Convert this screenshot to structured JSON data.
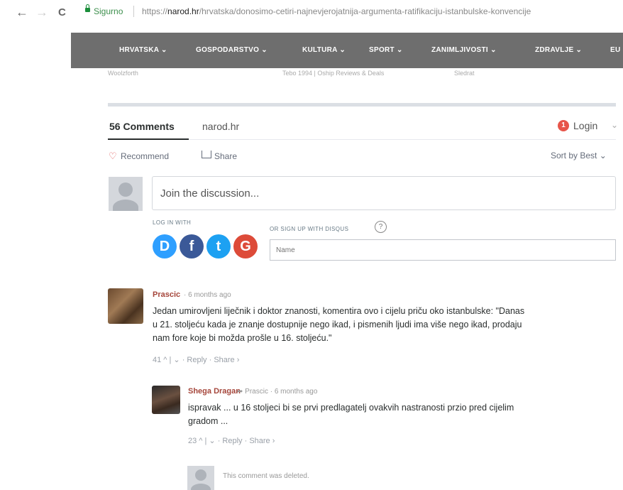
{
  "browser": {
    "back": "←",
    "forward": "→",
    "reload": "C",
    "secure_label": "Sigurno",
    "url_scheme": "https://",
    "url_domain": "narod.hr",
    "url_path": "/hrvatska/donosimo-cetiri-najnevjerojatnija-argumenta-ratifikaciju-istanbulske-konvencije"
  },
  "site_menu": [
    {
      "label": "HRVATSKA ⌄"
    },
    {
      "label": "GOSPODARSTVO ⌄"
    },
    {
      "label": "KULTURA ⌄"
    },
    {
      "label": "SPORT ⌄"
    },
    {
      "label": "ZANIMLJIVOSTI ⌄"
    },
    {
      "label": "ZDRAVLJE ⌄"
    },
    {
      "label": "EU"
    }
  ],
  "blurred_row": [
    "Woolzforth",
    "Tebo 1994 | Oship Reviews & Deals",
    "Sledrat"
  ],
  "disqus": {
    "comment_count": "56 Comments",
    "forum": "narod.hr",
    "login_badge": "1",
    "login": "Login",
    "login_caret": "⌄",
    "recommend": "Recommend",
    "share": "Share",
    "sort": "Sort by Best ⌄",
    "join_placeholder": "Join the discussion...",
    "log_in_with": "LOG IN WITH",
    "sign_up": "OR SIGN UP WITH DISQUS",
    "qmark": "?",
    "name_placeholder": "Name",
    "social": [
      {
        "letter": "D",
        "color": "#2e9fff"
      },
      {
        "letter": "f",
        "color": "#3b5998"
      },
      {
        "letter": "t",
        "color": "#1da1f2"
      },
      {
        "letter": "G",
        "color": "#dd4b39"
      }
    ]
  },
  "comments": [
    {
      "author": "Prascic",
      "meta": "· 6 months ago",
      "lines": [
        "Jedan umirovljeni liječnik i doktor znanosti, komentira ovo i cijelu priču oko istanbulske: \"Danas",
        "u 21. stoljeću kada je znanje dostupnije nego ikad, i pismenih ljudi ima više nego ikad, prodaju",
        "nam fore koje bi možda prošle u 16. stoljeću.\""
      ],
      "actions": "41 ^  |  ⌄  · Reply · Share ›"
    },
    {
      "author": "Shega Dragan",
      "reply_to": "➦ Prascic · 6 months ago",
      "lines": [
        "ispravak ... u 16 stoljeci bi se prvi predlagatelj ovakvih nastranosti przio pred cijelim",
        "gradom ..."
      ],
      "actions": "23 ^  |  ⌄  · Reply · Share ›"
    }
  ],
  "deleted_notice": "This comment was deleted."
}
